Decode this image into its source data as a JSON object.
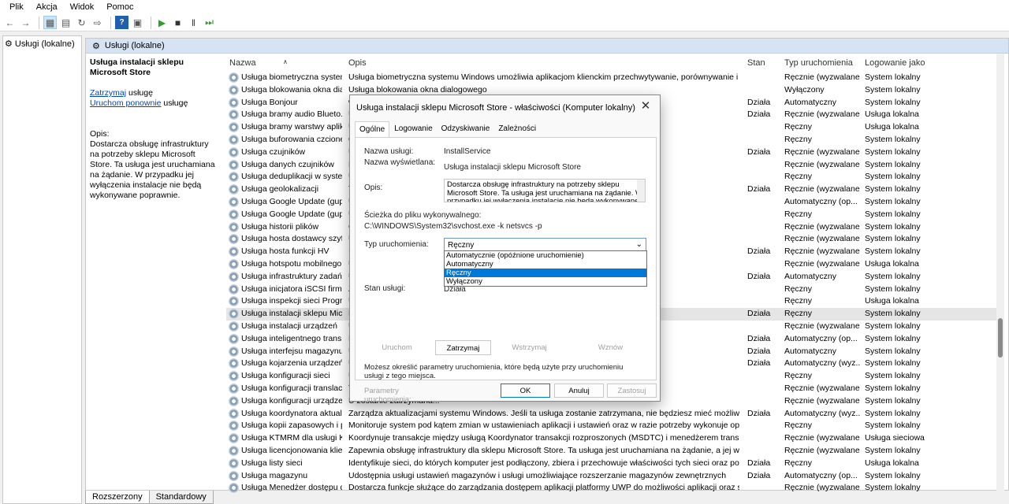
{
  "menu": [
    "Plik",
    "Akcja",
    "Widok",
    "Pomoc"
  ],
  "tree": {
    "root": "Usługi (lokalne)"
  },
  "content_header": "Usługi (lokalne)",
  "left_pane": {
    "service_title": "Usługa instalacji sklepu Microsoft Store",
    "stop_link": "Zatrzymaj",
    "stop_suffix": " usługę",
    "restart_link": "Uruchom ponownie",
    "restart_suffix": " usługę",
    "desc_label": "Opis:",
    "desc_text": "Dostarcza obsługę infrastruktury na potrzeby sklepu Microsoft Store. Ta usługa jest uruchamiana na żądanie. W przypadku jej wyłączenia instalacje nie będą wykonywane poprawnie."
  },
  "columns": {
    "name": "Nazwa",
    "desc": "Opis",
    "state": "Stan",
    "type": "Typ uruchomienia",
    "log": "Logowanie jako"
  },
  "rows": [
    {
      "name": "Usługa biometryczna system...",
      "desc": "Usługa biometryczna systemu Windows umożliwia aplikacjom klienckim przechwytywanie, porównywanie i przec...",
      "state": "",
      "type": "Ręcznie (wyzwalane...",
      "log": "System lokalny"
    },
    {
      "name": "Usługa blokowania okna dial...",
      "desc": "Usługa blokowania okna dialogowego",
      "state": "",
      "type": "Wyłączony",
      "log": "System lokalny"
    },
    {
      "name": "Usługa Bonjour",
      "desc": "                                                                                            wać swoją obecność.",
      "state": "Działa",
      "type": "Automatyczny",
      "log": "System lokalny"
    },
    {
      "name": "Usługa bramy audio Blueto...",
      "desc": "U",
      "state": "Działa",
      "type": "Ręcznie (wyzwalane...",
      "log": "Usługa lokalna"
    },
    {
      "name": "Usługa bramy warstwy aplik...",
      "desc": "U                                                                                           go.",
      "state": "",
      "type": "Ręczny",
      "log": "Usługa lokalna"
    },
    {
      "name": "Usługa buforowania czcione...",
      "desc": "O                                                                                           używane dane zcio...",
      "state": "",
      "type": "Ręczny",
      "log": "System lokalny"
    },
    {
      "name": "Usługa czujników",
      "desc": "U                                                                                           jest urządzenia i histo...",
      "state": "Działa",
      "type": "Ręcznie (wyzwalane...",
      "log": "System lokalny"
    },
    {
      "name": "Usługa danych czujników",
      "desc": "D",
      "state": "",
      "type": "Ręcznie (wyzwalane...",
      "log": "System lokalny"
    },
    {
      "name": "Usługa deduplikacji w syste...",
      "desc": "U                                                                                           i uruchamiania zapl...",
      "state": "",
      "type": "Ręczny",
      "log": "System lokalny"
    },
    {
      "name": "Usługa geolokalizacji",
      "desc": "Ta                                                                                          eniem geograficzny...",
      "state": "Działa",
      "type": "Ręcznie (wyzwalane...",
      "log": "System lokalny"
    },
    {
      "name": "Usługa Google Update (gup...",
      "desc": "U                                                                                           lub zatrzymana, pro...",
      "state": "",
      "type": "Automatyczny (op...",
      "log": "System lokalny"
    },
    {
      "name": "Usługa Google Update (gup...",
      "desc": "U                                                                                           lub zatrzymana, pro...",
      "state": "",
      "type": "Ręczny",
      "log": "System lokalny"
    },
    {
      "name": "Usługa historii plików",
      "desc": "C                                                                                           iub zatrzymana, pro...",
      "state": "",
      "type": "Ręcznie (wyzwalane...",
      "log": "System lokalny"
    },
    {
      "name": "Usługa hosta dostawcy szyfr...",
      "desc": "U                                                                                           ianiem od zewnętrzn...",
      "state": "",
      "type": "Ręcznie (wyzwalane...",
      "log": "System lokalny"
    },
    {
      "name": "Usługa hosta funkcji HV",
      "desc": "In                                                                                          partycji w systemie op...",
      "state": "Działa",
      "type": "Ręcznie (wyzwalane...",
      "log": "System lokalny"
    },
    {
      "name": "Usługa hotspotu mobilnego...",
      "desc": "U",
      "state": "",
      "type": "Ręcznie (wyzwalane...",
      "log": "Usługa lokalna"
    },
    {
      "name": "Usługa infrastruktury zadań ...",
      "desc": "U                                                                                           ane w systemie.",
      "state": "Działa",
      "type": "Automatyczny",
      "log": "System lokalny"
    },
    {
      "name": "Usługa inicjatora iSCSI firmy ...",
      "desc": "Z                                                                                           dzeniami docelowy...",
      "state": "",
      "type": "Ręczny",
      "log": "System lokalny"
    },
    {
      "name": "Usługa inspekcji sieci Progra...",
      "desc": "U                                                                                           rotokołach sieciowych",
      "state": "",
      "type": "Ręczny",
      "log": "Usługa lokalna"
    },
    {
      "name": "Usługa instalacji sklepu Micr...",
      "desc": "D                                                                                           nana na żądanie. W p...",
      "state": "Działa",
      "type": "Ręczny",
      "log": "System lokalny",
      "selected": true
    },
    {
      "name": "Usługa instalacji urządzeń",
      "desc": "U                                                                                           eznacznym udziale u...",
      "state": "",
      "type": "Ręcznie (wyzwalane...",
      "log": "System lokalny"
    },
    {
      "name": "Usługa inteligentnego trans...",
      "desc": "P                                                                                           ie (wyzwalana, wszystkie...",
      "state": "Działa",
      "type": "Automatyczny (op...",
      "log": "System lokalny"
    },
    {
      "name": "Usługa interfejsu magazynu ...",
      "desc": "U                                                                                           entów działających w t...",
      "state": "Działa",
      "type": "Automatyczny",
      "log": "System lokalny"
    },
    {
      "name": "Usługa kojarzenia urządzeń",
      "desc": "U",
      "state": "Działa",
      "type": "Automatyczny (wyz...",
      "log": "System lokalny"
    },
    {
      "name": "Usługa konfiguracji sieci",
      "desc": "U                                                                                           vi sieci niskiego po...",
      "state": "",
      "type": "Ręczny",
      "log": "System lokalny"
    },
    {
      "name": "Usługa konfiguracji translacj...",
      "desc": "Ta",
      "state": "",
      "type": "Ręcznie (wyzwalane...",
      "log": "System lokalny"
    },
    {
      "name": "Usługa konfiguracji urządze...",
      "desc": "U                                                                                           zostanie zatrzymana...",
      "state": "",
      "type": "Ręcznie (wyzwalane...",
      "log": "System lokalny"
    },
    {
      "name": "Usługa koordynatora aktuali...",
      "desc": "Zarządza aktualizacjami systemu Windows. Jeśli ta usługa zostanie zatrzymana, nie będziesz mieć możliwości pobi...",
      "state": "Działa",
      "type": "Automatyczny (wyz...",
      "log": "System lokalny"
    },
    {
      "name": "Usługa kopii zapasowych i p...",
      "desc": "Monitoruje system pod kątem zmian w ustawieniach aplikacji i ustawień oraz w razie potrzeby wykonuje operacje twor...",
      "state": "",
      "type": "Ręczny",
      "log": "System lokalny"
    },
    {
      "name": "Usługa KTMRM dla usługi K...",
      "desc": "Koordynuje transakcje między usługą Koordynator transakcji rozproszonych (MSDTC) i menedżerem transakcji jąd...",
      "state": "",
      "type": "Ręcznie (wyzwalane...",
      "log": "Usługa sieciowa"
    },
    {
      "name": "Usługa licencjonowania klie...",
      "desc": "Zapewnia obsługę infrastruktury dla sklepu Microsoft Store. Ta usługa jest uruchamiana na żądanie, a jej wyłącze...",
      "state": "",
      "type": "Ręcznie (wyzwalane...",
      "log": "System lokalny"
    },
    {
      "name": "Usługa listy sieci",
      "desc": "Identyfikuje sieci, do których komputer jest podłączony, zbiera i przechowuje właściwości tych sieci oraz powiada...",
      "state": "Działa",
      "type": "Ręczny",
      "log": "Usługa lokalna"
    },
    {
      "name": "Usługa magazynu",
      "desc": "Udostępnia usługi ustawień magazynów i usługi umożliwiające rozszerzanie magazynów zewnętrznych",
      "state": "Działa",
      "type": "Automatyczny (op...",
      "log": "System lokalny"
    },
    {
      "name": "Usługa Menedżer dostępu d...",
      "desc": "Dostarcza funkcje służące do zarządzania dostępem aplikacji platformy UWP do możliwości aplikacji oraz sprawdz...",
      "state": "",
      "type": "Ręcznie (wyzwalane...",
      "log": "System lokalny"
    }
  ],
  "bottom_tabs": [
    "Rozszerzony",
    "Standardowy"
  ],
  "dialog": {
    "title": "Usługa instalacji sklepu Microsoft Store - właściwości (Komputer lokalny)",
    "tabs": [
      "Ogólne",
      "Logowanie",
      "Odzyskiwanie",
      "Zależności"
    ],
    "service_name_label": "Nazwa usługi:",
    "service_name": "InstallService",
    "display_name_label": "Nazwa wyświetlana:",
    "display_name": "Usługa instalacji sklepu Microsoft Store",
    "desc_label": "Opis:",
    "desc_text": "Dostarcza obsługę infrastruktury na potrzeby sklepu Microsoft Store. Ta usługa jest uruchamiana na żądanie. W przypadku jej wyłączenia instalacje nie będą wykonywane poprawnie.",
    "path_label": "Ścieżka do pliku wykonywalnego:",
    "path": "C:\\WINDOWS\\System32\\svchost.exe -k netsvcs -p",
    "startup_label": "Typ uruchomienia:",
    "startup_value": "Ręczny",
    "startup_options": [
      "Automatycznie (opóźnione uruchomienie)",
      "Automatyczny",
      "Ręczny",
      "Wyłączony"
    ],
    "status_label": "Stan usługi:",
    "status_value": "Działa",
    "btn_start": "Uruchom",
    "btn_stop": "Zatrzymaj",
    "btn_pause": "Wstrzymaj",
    "btn_resume": "Wznów",
    "params_note": "Możesz określić parametry uruchomienia, które będą użyte przy uruchomieniu usługi z tego miejsca.",
    "params_label": "Parametry uruchomienia:",
    "ok": "OK",
    "cancel": "Anuluj",
    "apply": "Zastosuj"
  }
}
